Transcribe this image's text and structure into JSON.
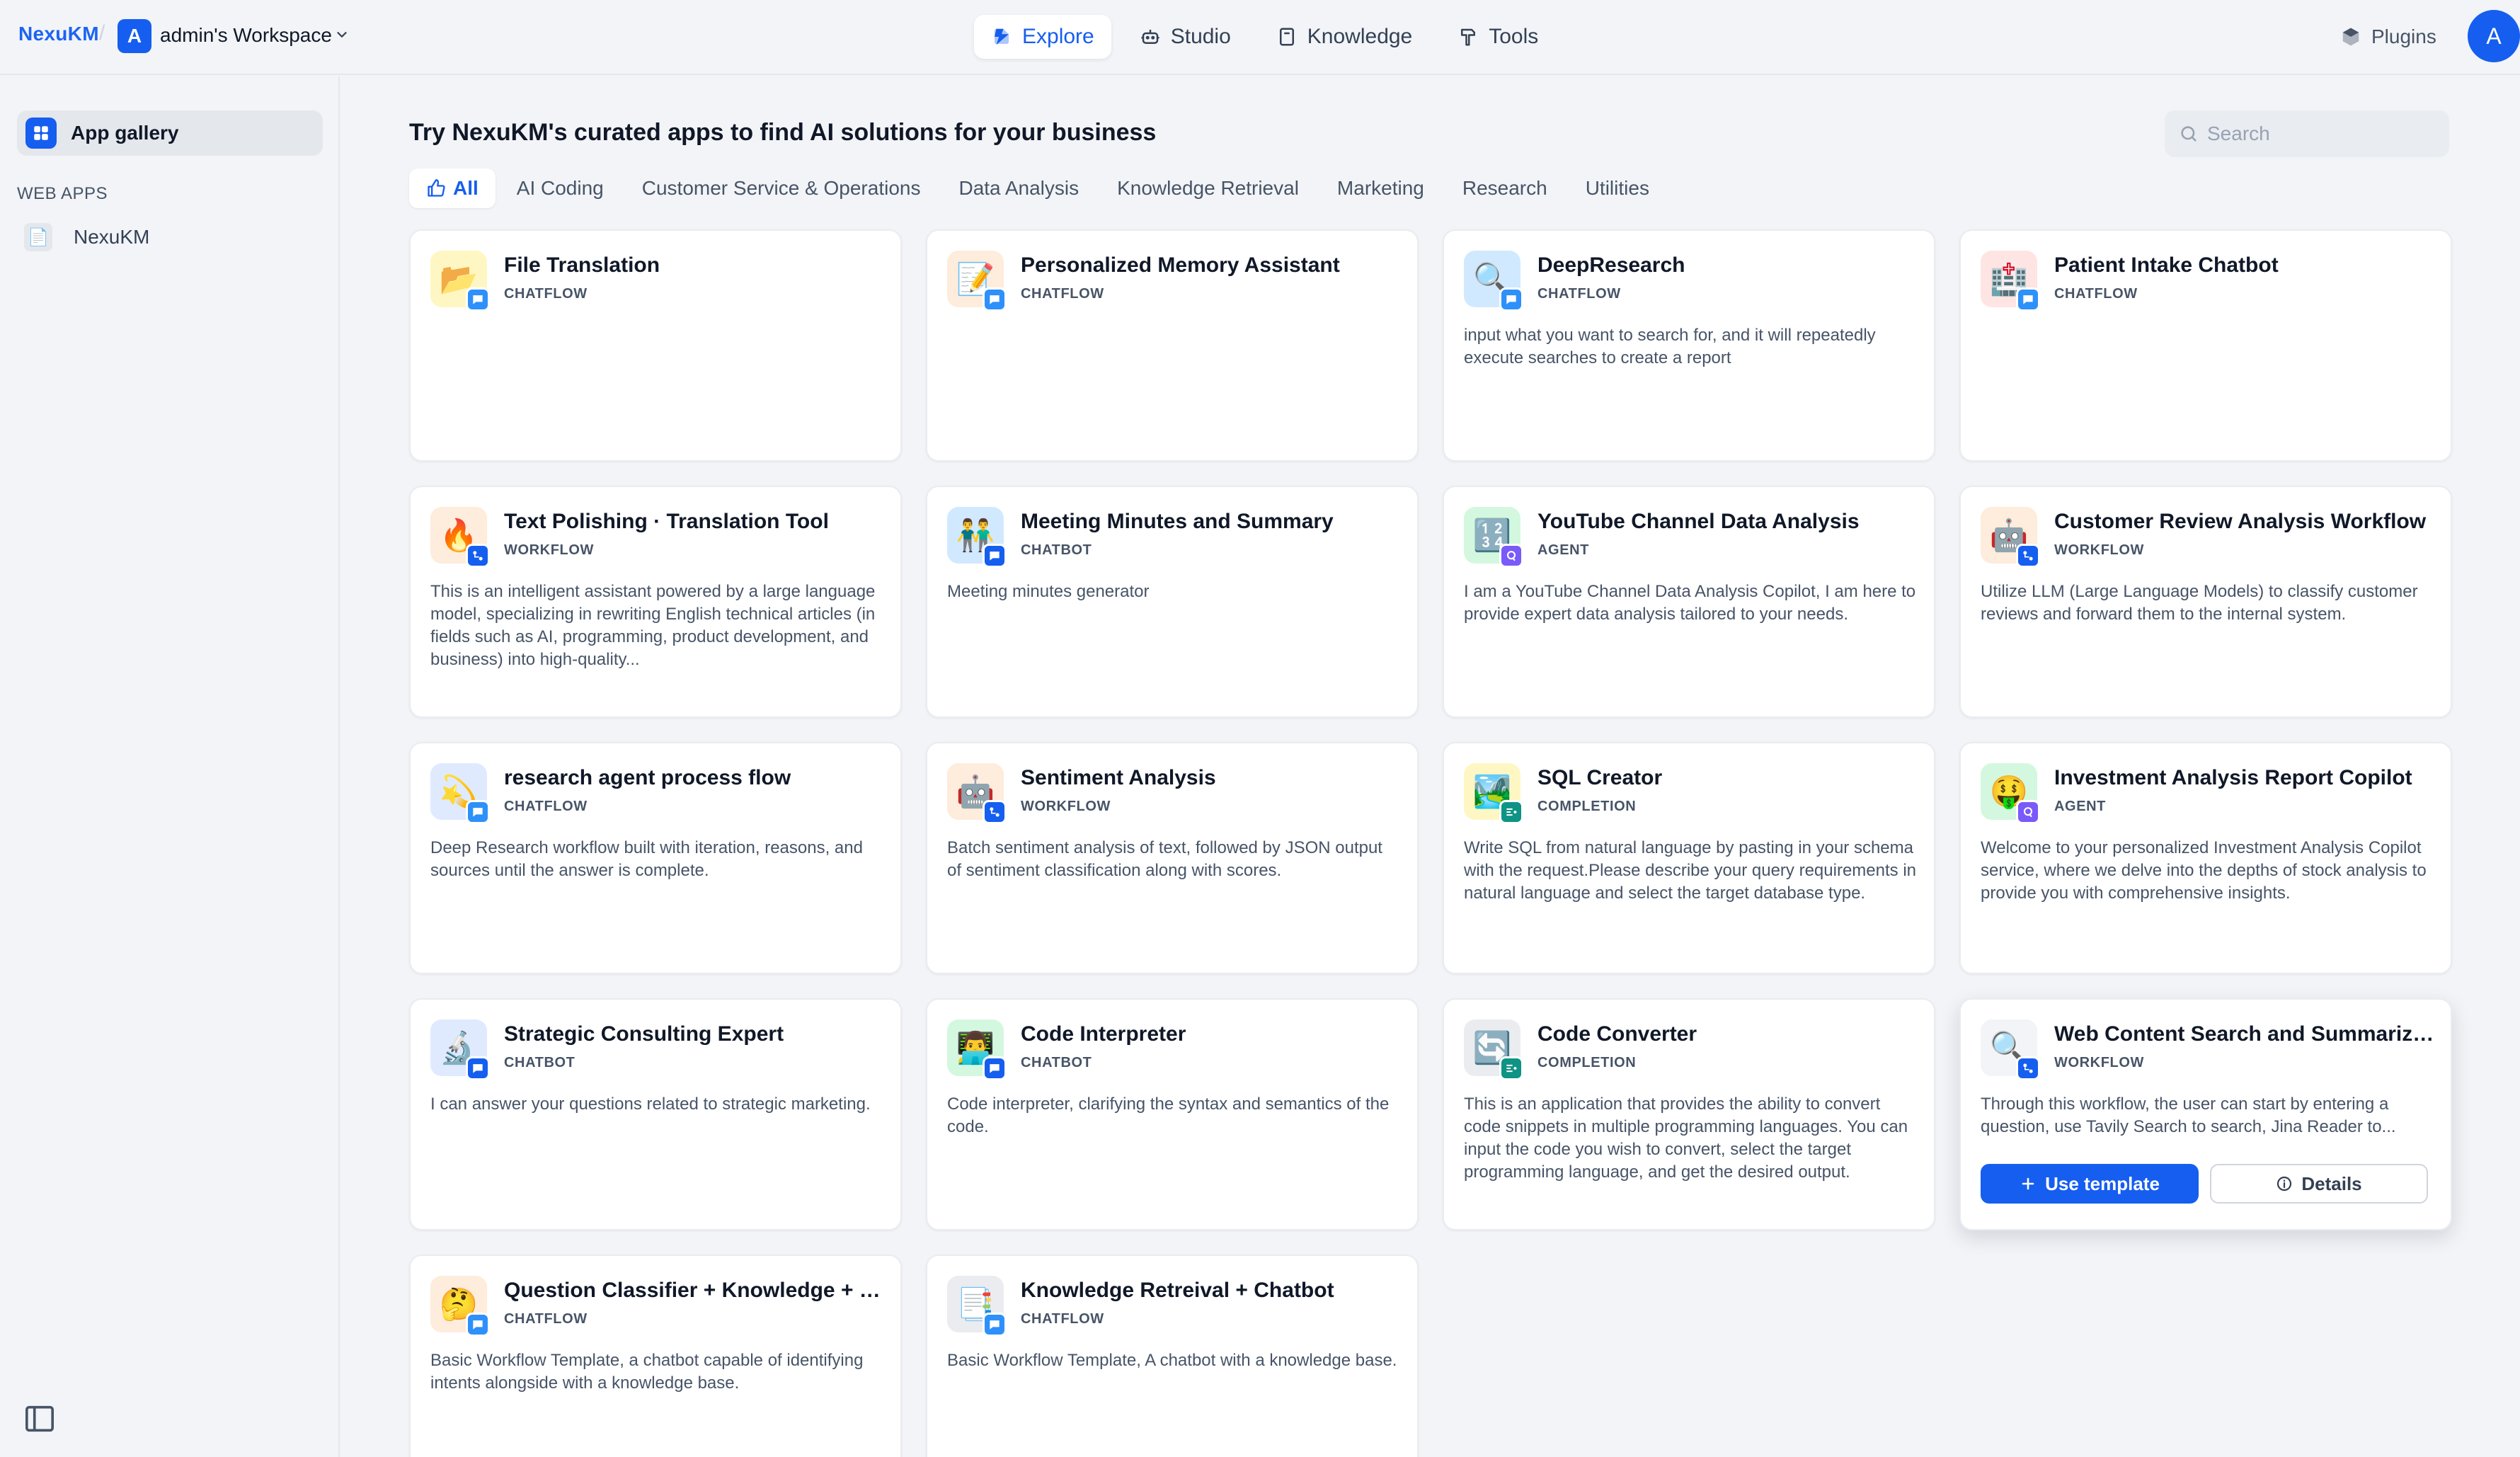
{
  "header": {
    "brand": "NexuKM",
    "separator": "/",
    "workspace_initial": "A",
    "workspace_name": "admin's Workspace",
    "nav": [
      {
        "label": "Explore",
        "icon": "compass-icon",
        "active": true
      },
      {
        "label": "Studio",
        "icon": "robot-icon"
      },
      {
        "label": "Knowledge",
        "icon": "book-icon"
      },
      {
        "label": "Tools",
        "icon": "hammer-icon"
      }
    ],
    "plugins_label": "Plugins",
    "user_initial": "A"
  },
  "sidebar": {
    "gallery_label": "App gallery",
    "section_label": "WEB APPS",
    "apps": [
      {
        "label": "NexuKM",
        "icon": "doc-icon"
      }
    ]
  },
  "main": {
    "title": "Try NexuKM's curated apps to find AI solutions for your business",
    "search_placeholder": "Search",
    "tabs": [
      "All",
      "AI Coding",
      "Customer Service & Operations",
      "Data Analysis",
      "Knowledge Retrieval",
      "Marketing",
      "Research",
      "Utilities"
    ],
    "active_tab": "All",
    "use_template_label": "Use template",
    "details_label": "Details"
  },
  "colors": {
    "accent": "#155eef",
    "chatflow_badge": "#2e90fa",
    "workflow_badge": "#155eef",
    "agent_badge": "#7a5af8",
    "completion_badge": "#0e9384"
  },
  "cards": [
    {
      "title": "File Translation",
      "type": "CHATFLOW",
      "desc": "",
      "emoji": "📂",
      "bg": "#fef7c3"
    },
    {
      "title": "Personalized Memory Assistant",
      "type": "CHATFLOW",
      "desc": "",
      "emoji": "📝",
      "bg": "#feecdc"
    },
    {
      "title": "DeepResearch",
      "type": "CHATFLOW",
      "desc": "input what you want to search for, and it will repeatedly execute searches to create a report",
      "emoji": "🔍",
      "bg": "#d1e9ff"
    },
    {
      "title": "Patient Intake Chatbot",
      "type": "CHATFLOW",
      "desc": "",
      "emoji": "🏥",
      "bg": "#fee4e2"
    },
    {
      "title": "Text Polishing · Translation Tool",
      "type": "WORKFLOW",
      "desc": "This is an intelligent assistant powered by a large language model, specializing in rewriting English technical articles (in fields such as AI, programming, product development, and business) into high-quality...",
      "emoji": "🔥",
      "bg": "#feecdc"
    },
    {
      "title": "Meeting Minutes and Summary",
      "type": "CHATBOT",
      "desc": "Meeting minutes generator",
      "emoji": "👬",
      "bg": "#d1e9ff"
    },
    {
      "title": "YouTube Channel Data Analysis",
      "type": "AGENT",
      "desc": "I am a YouTube Channel Data Analysis Copilot, I am here to provide expert data analysis tailored to your needs.",
      "emoji": "🔢",
      "bg": "#d3f8df"
    },
    {
      "title": "Customer Review Analysis Workflow",
      "type": "WORKFLOW",
      "desc": "Utilize LLM (Large Language Models) to classify customer reviews and forward them to the internal system.",
      "emoji": "🤖",
      "bg": "#feecdc"
    },
    {
      "title": "research agent process flow",
      "type": "CHATFLOW",
      "desc": "Deep Research workflow built with iteration, reasons, and sources until the answer is complete.",
      "emoji": "💫",
      "bg": "#e0eaff"
    },
    {
      "title": "Sentiment Analysis",
      "type": "WORKFLOW",
      "desc": "Batch sentiment analysis of text, followed by JSON output of sentiment classification along with scores.",
      "emoji": "🤖",
      "bg": "#feecdc"
    },
    {
      "title": "SQL Creator",
      "type": "COMPLETION",
      "desc": "Write SQL from natural language by pasting in your schema with the request.Please describe your query requirements in natural language and select the target database type.",
      "emoji": "🏞️",
      "bg": "#fef7c3"
    },
    {
      "title": "Investment Analysis Report Copilot",
      "type": "AGENT",
      "desc": "Welcome to your personalized Investment Analysis Copilot service, where we delve into the depths of stock analysis to provide you with comprehensive insights.",
      "emoji": "🤑",
      "bg": "#d3f8df"
    },
    {
      "title": "Strategic Consulting Expert",
      "type": "CHATBOT",
      "desc": "I can answer your questions related to strategic marketing.",
      "emoji": "🔬",
      "bg": "#e0eaff"
    },
    {
      "title": "Code Interpreter",
      "type": "CHATBOT",
      "desc": "Code interpreter, clarifying the syntax and semantics of the code.",
      "emoji": "👨‍💻",
      "bg": "#d3f8df"
    },
    {
      "title": "Code Converter",
      "type": "COMPLETION",
      "desc": "This is an application that provides the ability to convert code snippets in multiple programming languages. You can input the code you wish to convert, select the target programming language, and get the desired output.",
      "emoji": "🔄",
      "bg": "#eaecf0"
    },
    {
      "title": "Web Content Search and Summarizat...",
      "type": "WORKFLOW",
      "desc": "Through this workflow, the user can start by entering a question, use Tavily Search to search, Jina Reader to...",
      "emoji": "🔍",
      "bg": "#f2f4f7",
      "hovered": true
    },
    {
      "title": "Question Classifier + Knowledge + Ch...",
      "type": "CHATFLOW",
      "desc": "Basic Workflow Template, a chatbot capable of identifying intents alongside with a knowledge base.",
      "emoji": "🤔",
      "bg": "#feecdc"
    },
    {
      "title": "Knowledge Retreival + Chatbot",
      "type": "CHATFLOW",
      "desc": "Basic Workflow Template, A chatbot with a knowledge base.",
      "emoji": "📑",
      "bg": "#eaecf0"
    }
  ]
}
